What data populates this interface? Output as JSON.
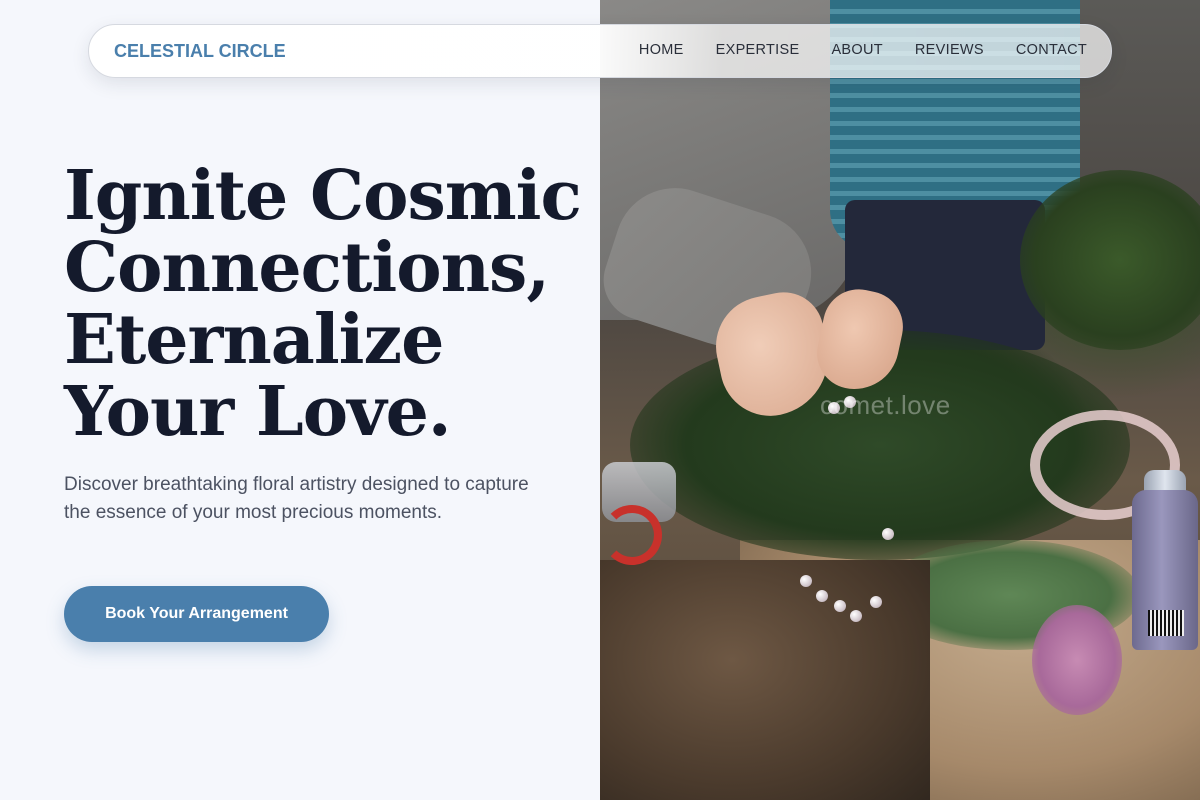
{
  "nav": {
    "brand": "CELESTIAL CIRCLE",
    "links": [
      "HOME",
      "EXPERTISE",
      "ABOUT",
      "REVIEWS",
      "CONTACT"
    ]
  },
  "hero": {
    "title_lines": [
      "Ignite Cosmic",
      "Connections,",
      "Eternalize",
      "Your Love."
    ],
    "subtitle": "Discover breathtaking floral artistry designed to capture the essence of your most precious moments.",
    "cta_label": "Book Your Arrangement"
  },
  "photo": {
    "watermark": "comet.love"
  },
  "colors": {
    "accent": "#4a7fac",
    "heading": "#141a2c",
    "body_text": "#4c5262",
    "background": "#f5f7fc"
  }
}
